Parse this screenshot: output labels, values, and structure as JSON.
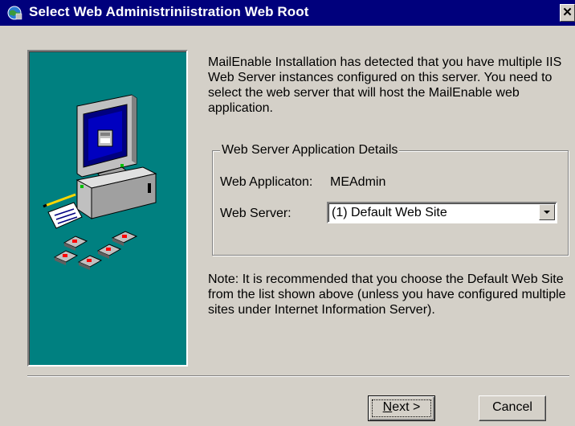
{
  "window": {
    "title": "Select Web Administriniistration Web Root"
  },
  "intro": {
    "text": "MailEnable Installation has detected that you have multiple IIS Web Server instances configured on this server. You need to select the web server that will host the MailEnable web application."
  },
  "group": {
    "label": "Web Server Application Details",
    "web_application_label": "Web Applicaton:",
    "web_application_value": "MEAdmin",
    "web_server_label": "Web Server:",
    "web_server_value": "(1) Default Web Site"
  },
  "note": {
    "text": "Note: It is recommended that you choose the Default Web Site from the list shown above (unless you have configured multiple sites under Internet Information Server)."
  },
  "buttons": {
    "next_mnemonic": "N",
    "next_rest": "ext >",
    "cancel": "Cancel"
  },
  "colors": {
    "titlebar": "#00007c",
    "side_panel": "#008080",
    "dialog": "#d4d0c8"
  }
}
